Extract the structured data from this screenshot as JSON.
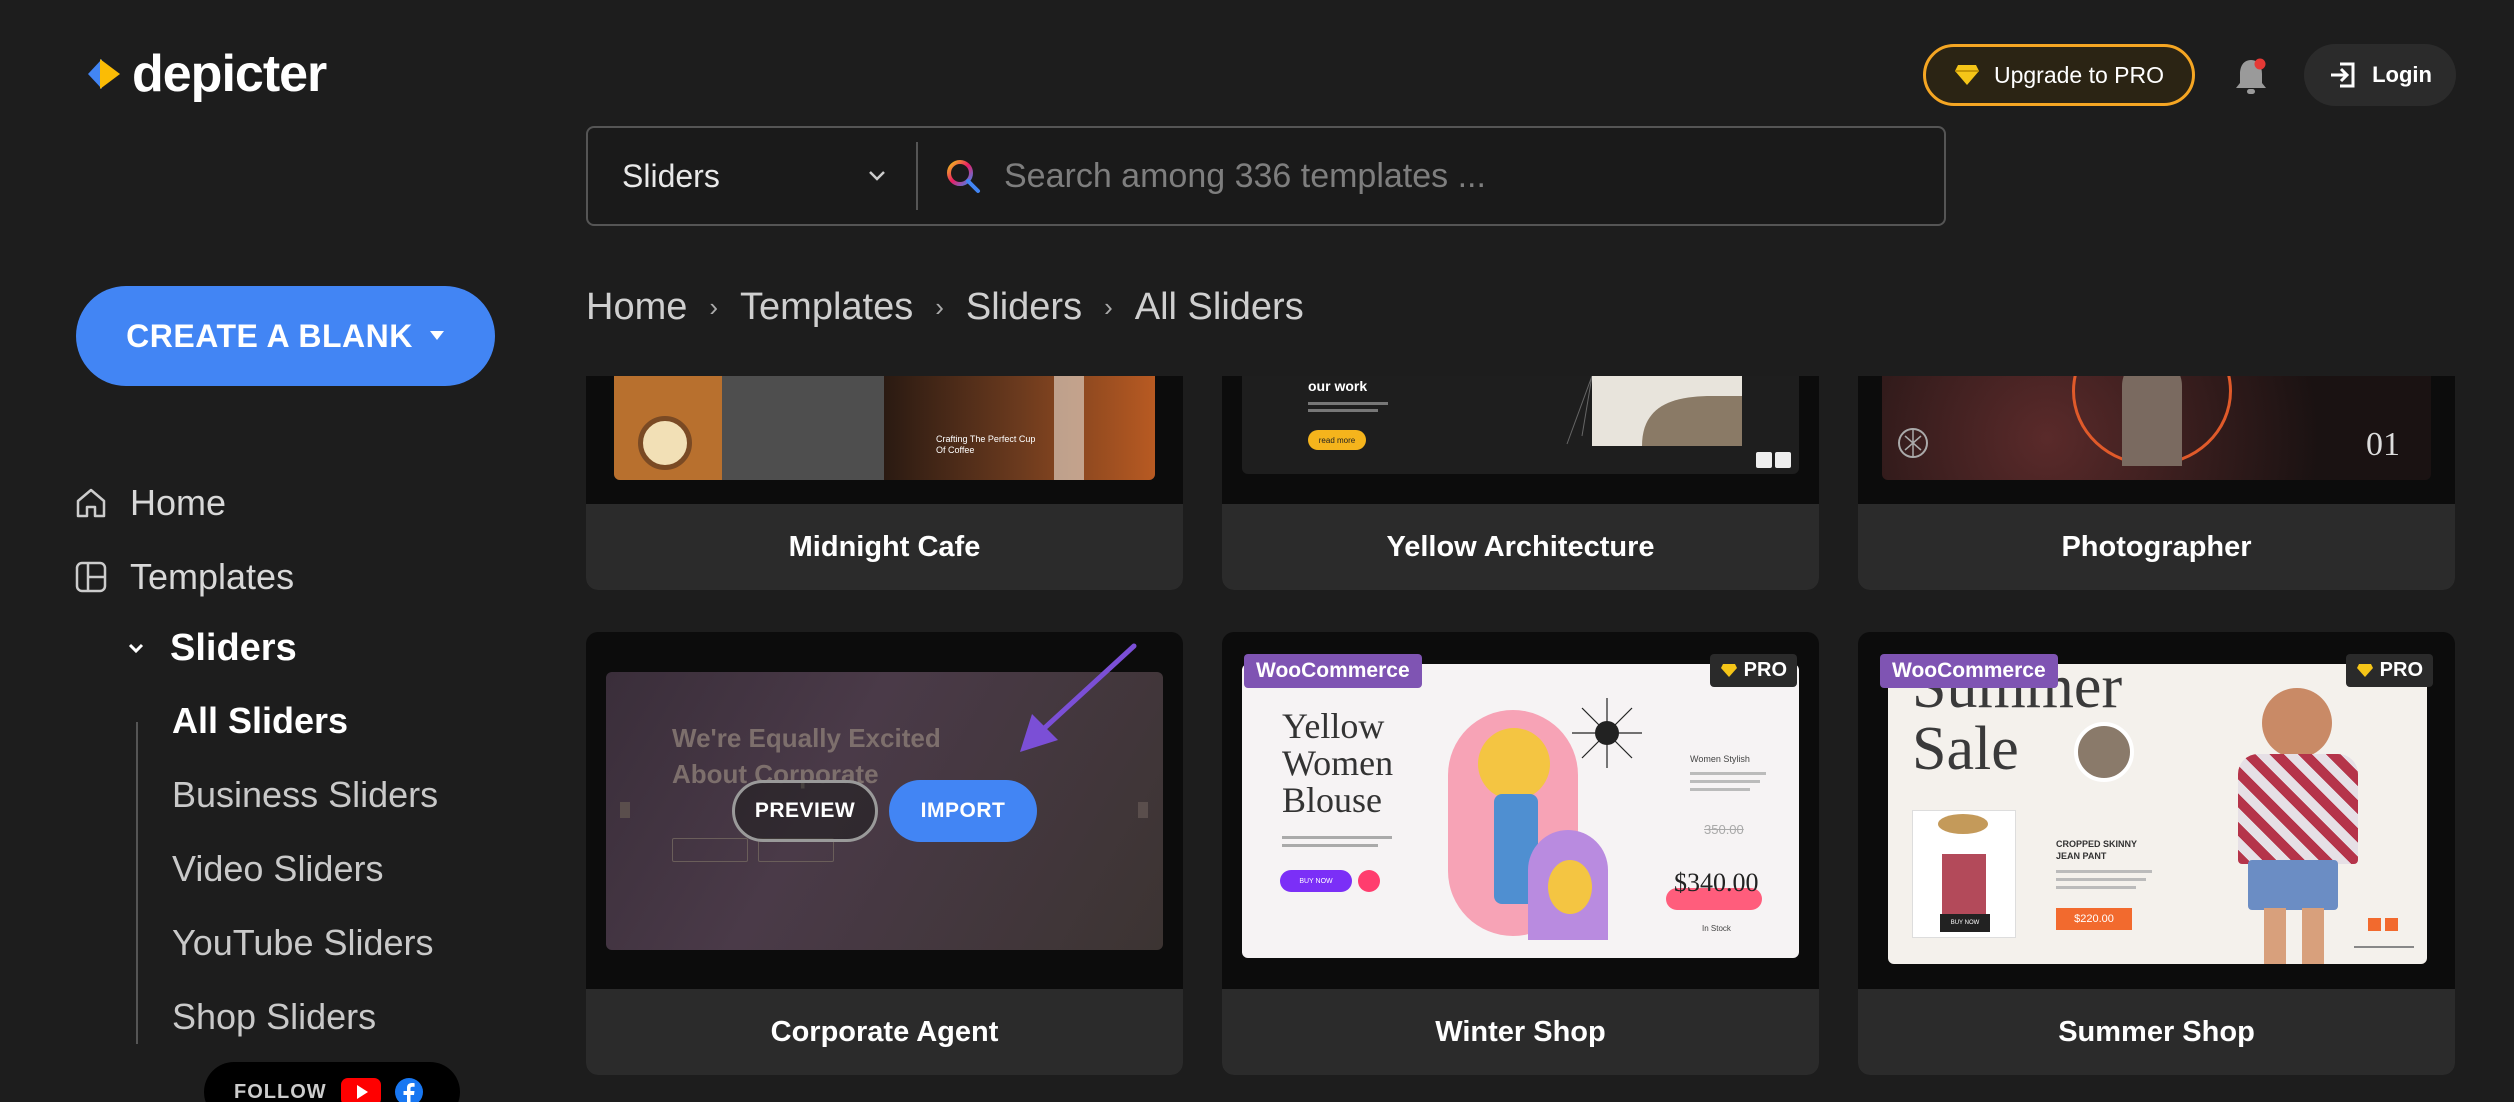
{
  "brand": {
    "name": "depicter"
  },
  "header": {
    "upgrade_label": "Upgrade to PRO",
    "login_label": "Login"
  },
  "search": {
    "category": "Sliders",
    "placeholder": "Search among 336 templates ..."
  },
  "sidebar": {
    "create_label": "CREATE A BLANK",
    "nav": [
      {
        "label": "Home",
        "icon": "home-icon"
      },
      {
        "label": "Templates",
        "icon": "templates-icon"
      }
    ],
    "sub_heading": "Sliders",
    "sub_items": [
      {
        "label": "All Sliders",
        "active": true
      },
      {
        "label": "Business Sliders",
        "active": false
      },
      {
        "label": "Video Sliders",
        "active": false
      },
      {
        "label": "YouTube Sliders",
        "active": false
      },
      {
        "label": "Shop Sliders",
        "active": false
      }
    ],
    "follow_label": "FOLLOW"
  },
  "breadcrumb": [
    "Home",
    "Templates",
    "Sliders",
    "All Sliders"
  ],
  "templates": [
    {
      "name": "Midnight Cafe"
    },
    {
      "name": "Yellow Architecture"
    },
    {
      "name": "Photographer"
    },
    {
      "name": "Corporate Agent",
      "preview_label": "PREVIEW",
      "import_label": "IMPORT"
    },
    {
      "name": "Winter Shop",
      "tag": "WooCommerce",
      "pro": "PRO"
    },
    {
      "name": "Summer Shop",
      "tag": "WooCommerce",
      "pro": "PRO"
    }
  ],
  "thumbnails": {
    "midnight_cafe": {
      "text": "Crafting The Perfect Cup Of Coffee"
    },
    "yellow_architecture": {
      "heading": "our work",
      "button": "read more"
    },
    "photographer": {
      "number": "01"
    },
    "corporate_agent": {
      "heading_line1": "We're Equally Excited",
      "heading_line2": "About Corporate"
    },
    "winter_shop": {
      "title_line1": "Yellow",
      "title_line2": "Women",
      "title_line3": "Blouse",
      "old_price": "350.00",
      "price": "$340.00",
      "stock": "In Stock",
      "product": "Women Stylish",
      "button": "BUY NOW"
    },
    "summer_shop": {
      "title_line1": "Summer",
      "title_line2": "Sale",
      "product": "CROPPED SKINNY JEAN PANT",
      "price": "$220.00",
      "button": "BUY NOW"
    }
  },
  "colors": {
    "accent": "#4285f4",
    "upgrade_border": "#f5a623",
    "woo": "#7f54b3",
    "arrow": "#7b4fd6"
  }
}
